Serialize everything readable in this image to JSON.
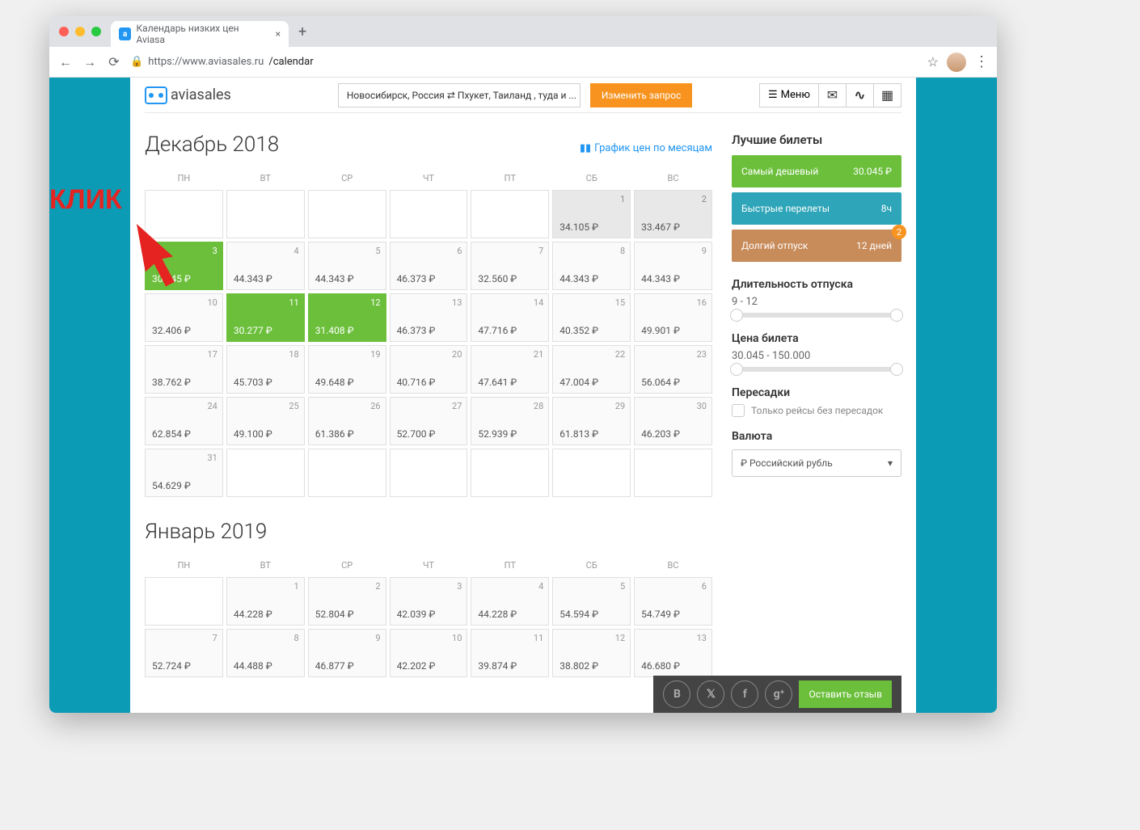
{
  "browser": {
    "tab_title": "Календарь низких цен Aviasa",
    "url_host": "https://www.aviasales.ru",
    "url_path": "/calendar"
  },
  "annotation": "КЛИК",
  "header": {
    "logo": "aviasales",
    "route": "Новосибирск, Россия ⇄ Пхукет, Таиланд , туда и ...",
    "change": "Изменить запрос",
    "menu": "Меню"
  },
  "dow": [
    "ПН",
    "ВТ",
    "СР",
    "ЧТ",
    "ПТ",
    "СБ",
    "ВС"
  ],
  "months": [
    {
      "title": "Декабрь 2018",
      "chart_link": "График цен по месяцам",
      "cells": [
        {
          "e": 1
        },
        {
          "e": 1
        },
        {
          "e": 1
        },
        {
          "e": 1
        },
        {
          "e": 1
        },
        {
          "d": "1",
          "p": "34.105 ₽",
          "g": 1
        },
        {
          "d": "2",
          "p": "33.467 ₽",
          "g": 1
        },
        {
          "d": "3",
          "p": "30.045 ₽",
          "gr": 1
        },
        {
          "d": "4",
          "p": "44.343 ₽"
        },
        {
          "d": "5",
          "p": "44.343 ₽"
        },
        {
          "d": "6",
          "p": "46.373 ₽"
        },
        {
          "d": "7",
          "p": "32.560 ₽"
        },
        {
          "d": "8",
          "p": "44.343 ₽"
        },
        {
          "d": "9",
          "p": "44.343 ₽"
        },
        {
          "d": "10",
          "p": "32.406 ₽"
        },
        {
          "d": "11",
          "p": "30.277 ₽",
          "gr": 1
        },
        {
          "d": "12",
          "p": "31.408 ₽",
          "gr": 1
        },
        {
          "d": "13",
          "p": "46.373 ₽"
        },
        {
          "d": "14",
          "p": "47.716 ₽"
        },
        {
          "d": "15",
          "p": "40.352 ₽"
        },
        {
          "d": "16",
          "p": "49.901 ₽"
        },
        {
          "d": "17",
          "p": "38.762 ₽"
        },
        {
          "d": "18",
          "p": "45.703 ₽"
        },
        {
          "d": "19",
          "p": "49.648 ₽"
        },
        {
          "d": "20",
          "p": "40.716 ₽"
        },
        {
          "d": "21",
          "p": "47.641 ₽"
        },
        {
          "d": "22",
          "p": "47.004 ₽"
        },
        {
          "d": "23",
          "p": "56.064 ₽"
        },
        {
          "d": "24",
          "p": "62.854 ₽"
        },
        {
          "d": "25",
          "p": "49.100 ₽"
        },
        {
          "d": "26",
          "p": "61.386 ₽"
        },
        {
          "d": "27",
          "p": "52.700 ₽"
        },
        {
          "d": "28",
          "p": "52.939 ₽"
        },
        {
          "d": "29",
          "p": "61.813 ₽"
        },
        {
          "d": "30",
          "p": "46.203 ₽"
        },
        {
          "d": "31",
          "p": "54.629 ₽"
        },
        {
          "e": 1
        },
        {
          "e": 1
        },
        {
          "e": 1
        },
        {
          "e": 1
        },
        {
          "e": 1
        },
        {
          "e": 1
        }
      ]
    },
    {
      "title": "Январь 2019",
      "cells": [
        {
          "e": 1
        },
        {
          "d": "1",
          "p": "44.228 ₽"
        },
        {
          "d": "2",
          "p": "52.804 ₽"
        },
        {
          "d": "3",
          "p": "42.039 ₽"
        },
        {
          "d": "4",
          "p": "44.228 ₽"
        },
        {
          "d": "5",
          "p": "54.594 ₽"
        },
        {
          "d": "6",
          "p": "54.749 ₽"
        },
        {
          "d": "7",
          "p": "52.724 ₽"
        },
        {
          "d": "8",
          "p": "44.488 ₽"
        },
        {
          "d": "9",
          "p": "46.877 ₽"
        },
        {
          "d": "10",
          "p": "42.202 ₽"
        },
        {
          "d": "11",
          "p": "39.874 ₽"
        },
        {
          "d": "12",
          "p": "38.802 ₽"
        },
        {
          "d": "13",
          "p": "46.680 ₽"
        }
      ]
    }
  ],
  "sidebar": {
    "best_title": "Лучшие билеты",
    "cards": [
      {
        "t": "Самый дешевый",
        "v": "30.045 ₽"
      },
      {
        "t": "Быстрые перелеты",
        "v": "8ч"
      },
      {
        "t": "Долгий отпуск",
        "v": "12 дней",
        "badge": "2"
      }
    ],
    "duration_title": "Длительность отпуска",
    "duration_range": "9 - 12",
    "price_title": "Цена билета",
    "price_range": "30.045 - 150.000",
    "stops_title": "Пересадки",
    "stops_check": "Только рейсы без пересадок",
    "currency_title": "Валюта",
    "currency_value": "₽ Российский рубль"
  },
  "review": "Оставить отзыв"
}
